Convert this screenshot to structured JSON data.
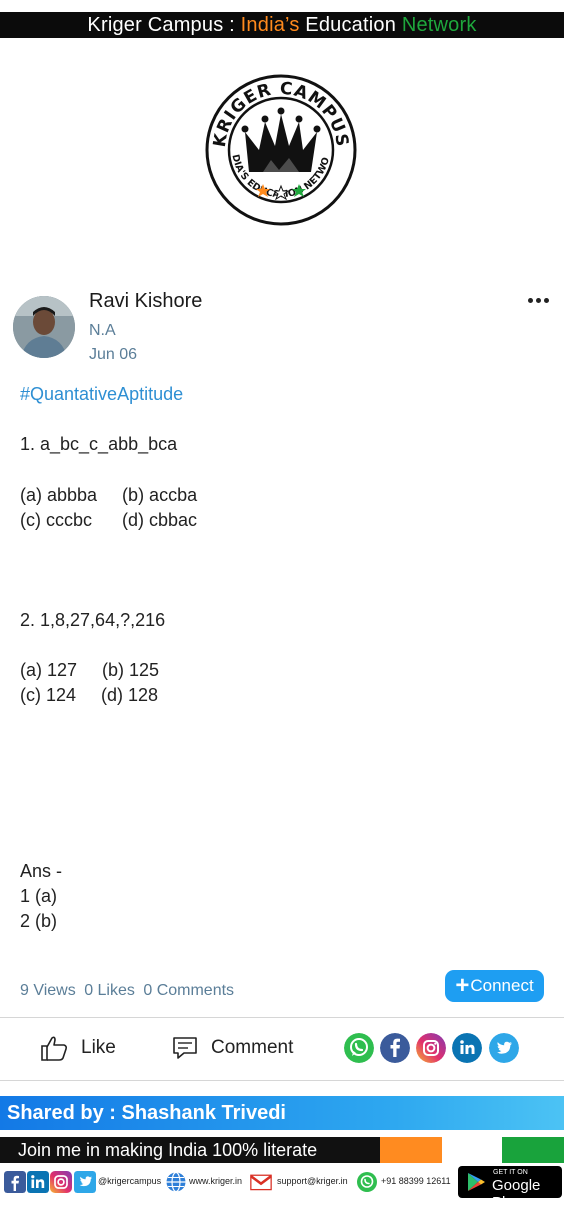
{
  "header": {
    "part1": "Kriger Campus : ",
    "part2": "India’s",
    "part3": " Education ",
    "part4": "Network"
  },
  "logo": {
    "top_text": "KRIGER CAMPUS",
    "ring_text": "INDIA'S EDUCATION NETWORK"
  },
  "post": {
    "author": "Ravi Kishore",
    "subtitle": "N.A",
    "date": "Jun 06",
    "hashtag": "#QuantativeAptitude",
    "q1": "1. a_bc_c_abb_bca",
    "q1_opts_a": "(a) abbba     (b) accba",
    "q1_opts_b": "(c) cccbc      (d) cbbac",
    "q2": "2. 1,8,27,64,?,216",
    "q2_opts_a": "(a) 127     (b) 125",
    "q2_opts_b": "(c) 124     (d) 128",
    "ans_title": "Ans -",
    "ans1": "1 (a)",
    "ans2": "2 (b)"
  },
  "stats": {
    "views": "9 Views",
    "likes": "0 Likes",
    "comments": "0 Comments"
  },
  "actions": {
    "connect_label": "Connect",
    "like_label": "Like",
    "comment_label": "Comment"
  },
  "share_icons": [
    "whatsapp-icon",
    "facebook-icon",
    "instagram-icon",
    "linkedin-icon",
    "twitter-icon"
  ],
  "footer": {
    "shared_by": "Shared by : Shashank Trivedi",
    "slogan": "Join me in making India 100% literate",
    "handle": "@krigercampus",
    "website": "www.kriger.in",
    "email": "support@kriger.in",
    "phone": "+91 88399 12611",
    "gplay_small": "GET IT ON",
    "gplay_big": "Google Play"
  },
  "colors": {
    "accent": "#1e9ef2",
    "meta": "#5b7e98",
    "hashtag": "#2e8fd3",
    "saffron": "#ff8a1d",
    "green": "#1ea73c"
  }
}
